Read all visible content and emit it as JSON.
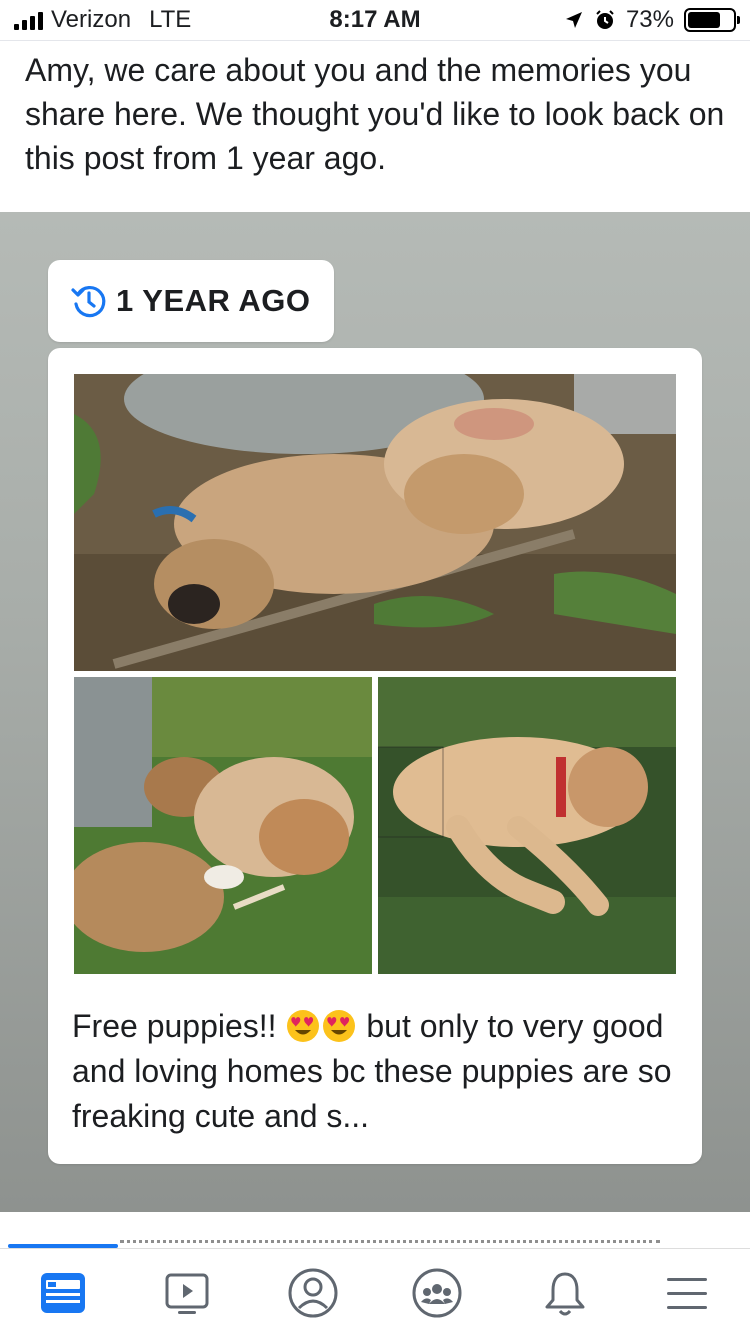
{
  "status_bar": {
    "carrier": "Verizon",
    "network": "LTE",
    "time": "8:17 AM",
    "battery": "73%",
    "battery_level": 0.73
  },
  "intro_text": "Amy, we care about you and the memories you share here. We thought you'd like to look back on this post from 1 year ago.",
  "memory": {
    "chip_label": "1 YEAR AGO",
    "chip_icon": "history-clock-icon",
    "post": {
      "caption_part1": "Free puppies!!",
      "caption_emoji": "heart-eyes-emoji",
      "caption_part2": "but only to very good and loving homes bc these puppies are so freaking cute and s..."
    }
  },
  "bottom_nav": {
    "items": [
      {
        "icon": "news-feed-icon",
        "active": true
      },
      {
        "icon": "watch-video-icon",
        "active": false
      },
      {
        "icon": "profile-icon",
        "active": false
      },
      {
        "icon": "groups-icon",
        "active": false
      },
      {
        "icon": "notifications-bell-icon",
        "active": false
      },
      {
        "icon": "menu-icon",
        "active": false
      }
    ]
  },
  "colors": {
    "accent": "#1877f2",
    "text": "#1c1e21"
  }
}
